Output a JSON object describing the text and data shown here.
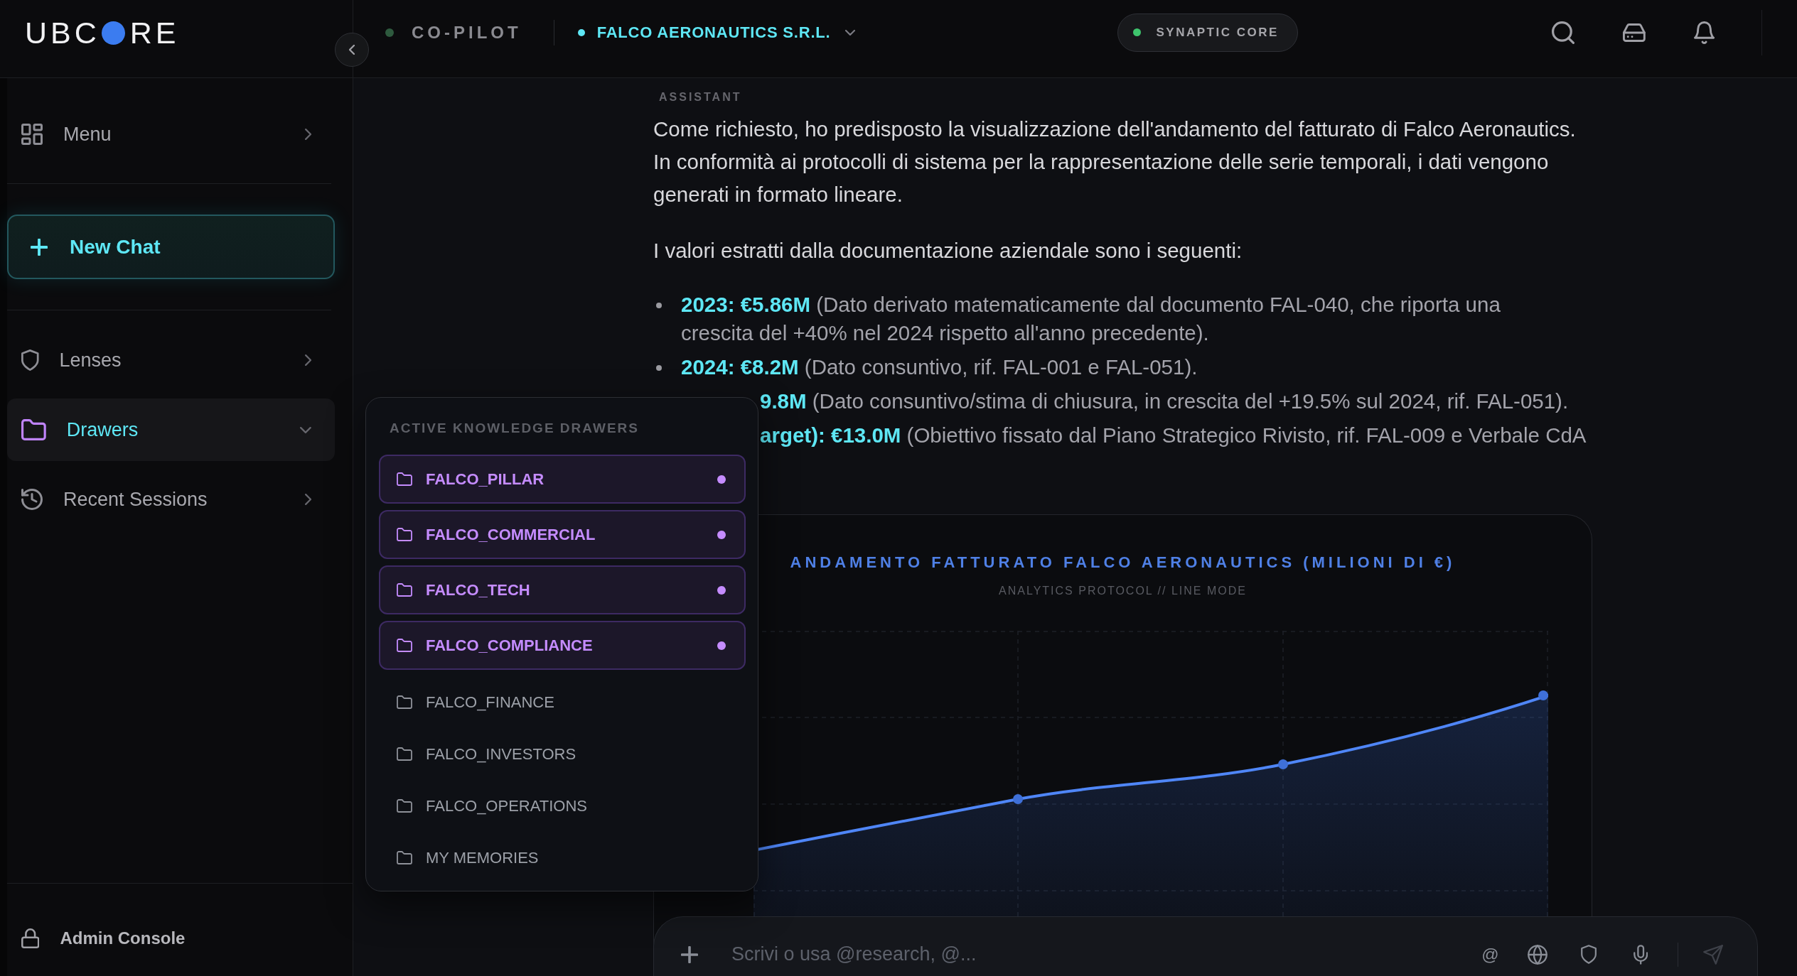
{
  "topbar": {
    "logo": {
      "start": "UBC",
      "end": "RE"
    },
    "mode": {
      "label": "CO-PILOT"
    },
    "workspace": {
      "label": "FALCO AERONAUTICS S.R.L."
    },
    "status": {
      "label": "SYNAPTIC CORE",
      "online": true
    }
  },
  "sidebar": {
    "menu": {
      "label": "Menu",
      "expanded": false
    },
    "new_chat": {
      "label": "New Chat"
    },
    "nav": [
      {
        "label": "Lenses",
        "selected": false,
        "expanded": false
      },
      {
        "label": "Drawers",
        "selected": true,
        "expanded": true
      },
      {
        "label": "Recent Sessions",
        "selected": false,
        "expanded": false
      }
    ],
    "footer": {
      "label": "Admin Console"
    }
  },
  "message": {
    "role": "ASSISTANT",
    "intro_lines": [
      "Come richiesto, ho predisposto la visualizzazione dell'andamento del fatturato di Falco Aeronautics.",
      "In conformità ai protocolli di sistema per la rappresentazione delle serie temporali, i dati vengono",
      "generati in formato lineare."
    ],
    "lead": "I valori estratti dalla documentazione aziendale sono i seguenti:",
    "items": [
      {
        "kind": "bullet",
        "lines": [
          "**2023: €5.86M** (Dato derivato matematicamente dal documento FAL-040, che riporta una",
          "crescita del +40% nel 2024 rispetto all'anno precedente)."
        ]
      },
      {
        "kind": "bullet",
        "lines": [
          "**2024: €8.2M** (Dato consuntivo, rif. FAL-001 e FAL-051)."
        ]
      },
      {
        "kind": "covered",
        "lines": [
          "**9.8M** (Dato consuntivo/stima di chiusura, in crescita del +19.5% sul 2024, rif. FAL-051)."
        ]
      },
      {
        "kind": "covered",
        "lines": [
          "**arget): €13.0M** (Obiettivo fissato dal Piano Strategico Rivisto, rif. FAL-009 e Verbale CdA"
        ]
      }
    ]
  },
  "chart": {
    "title": "ANDAMENTO FATTURATO FALCO AERONAUTICS (MILIONI DI €)",
    "subtitle": "ANALYTICS PROTOCOL // LINE MODE"
  },
  "drawers_popup": {
    "title": "ACTIVE KNOWLEDGE DRAWERS",
    "items": [
      {
        "label": "FALCO_PILLAR",
        "selected": true
      },
      {
        "label": "FALCO_COMMERCIAL",
        "selected": true
      },
      {
        "label": "FALCO_TECH",
        "selected": true
      },
      {
        "label": "FALCO_COMPLIANCE",
        "selected": true
      },
      {
        "label": "FALCO_FINANCE",
        "selected": false
      },
      {
        "label": "FALCO_INVESTORS",
        "selected": false
      },
      {
        "label": "FALCO_OPERATIONS",
        "selected": false
      },
      {
        "label": "MY MEMORIES",
        "selected": false
      }
    ]
  },
  "composer": {
    "placeholder": "Scrivi o usa @research, @...",
    "mention": "@"
  }
}
